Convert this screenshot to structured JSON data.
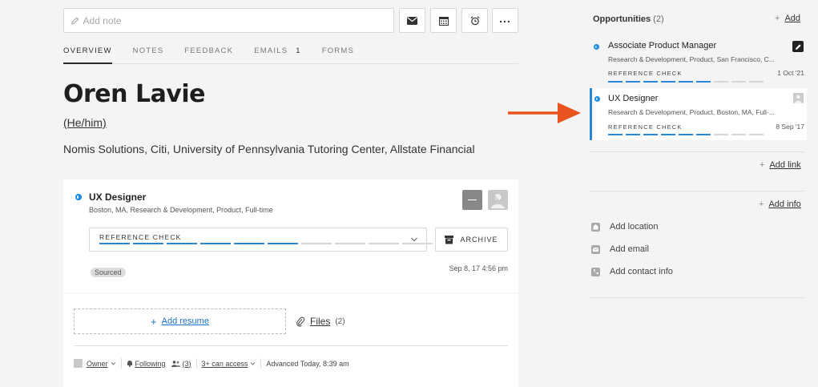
{
  "toolbar": {
    "note_placeholder": "Add note"
  },
  "tabs": [
    {
      "label": "OVERVIEW"
    },
    {
      "label": "NOTES"
    },
    {
      "label": "FEEDBACK"
    },
    {
      "label": "EMAILS",
      "count": "1"
    },
    {
      "label": "FORMS"
    }
  ],
  "profile": {
    "name": "Oren Lavie",
    "pronouns": "(He/him)",
    "companies": "Nomis Solutions, Citi, University of Pennsylvania Tutoring Center, Allstate Financial"
  },
  "opportunity_card": {
    "title": "UX Designer",
    "subtitle": "Boston, MA, Research & Development, Product, Full-time",
    "stage": "REFERENCE CHECK",
    "archive_label": "ARCHIVE",
    "source_badge": "Sourced",
    "timestamp": "Sep 8, 17 4:56 pm",
    "progress_done": 6,
    "progress_total": 10
  },
  "resume": {
    "add_resume": "Add resume",
    "files_label": "Files",
    "files_count": "(2)"
  },
  "footer": {
    "owner": "Owner",
    "following": "Following",
    "followers_count": "(3)",
    "access": "3+ can access",
    "advanced": "Advanced Today, 8:39 am"
  },
  "sidebar": {
    "opportunities_label": "Opportunities",
    "opportunities_count": "(2)",
    "add_label": "Add",
    "opportunities": [
      {
        "title": "Associate Product Manager",
        "subtitle": "Research & Development, Product, San Francisco, C...",
        "stage": "REFERENCE CHECK",
        "date": "1 Oct '21",
        "progress_done": 6,
        "progress_total": 9
      },
      {
        "title": "UX Designer",
        "subtitle": "Research & Development, Product, Boston, MA, Full-...",
        "stage": "REFERENCE CHECK",
        "date": "8 Sep '17",
        "progress_done": 6,
        "progress_total": 9
      }
    ],
    "add_link": "Add link",
    "add_info": "Add info",
    "info_items": [
      {
        "label": "Add location",
        "icon": "location-icon"
      },
      {
        "label": "Add email",
        "icon": "email-icon"
      },
      {
        "label": "Add contact info",
        "icon": "phone-icon"
      }
    ]
  },
  "colors": {
    "accent": "#1a72c8",
    "progress_on": "#2a87d8",
    "arrow": "#e8531e"
  }
}
